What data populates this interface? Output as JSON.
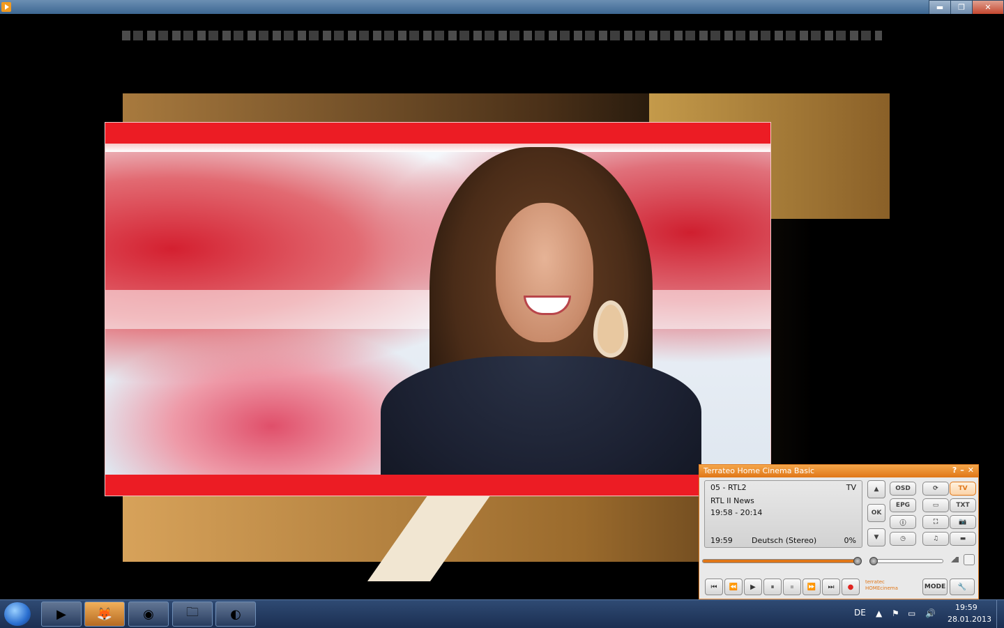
{
  "window": {
    "title": "",
    "minimize_label": "▬",
    "maximize_label": "❐",
    "close_label": "✕"
  },
  "player": {
    "title": "Terrateo Home Cinema Basic",
    "title_controls": [
      "?",
      "–",
      "✕"
    ],
    "display": {
      "channel": "05 - RTL2",
      "mode": "TV",
      "program": "RTL II News",
      "time_range": "19:58 - 20:14",
      "current_time": "19:59",
      "audio": "Deutsch (Stereo)",
      "percent": "0%"
    },
    "nav_buttons": {
      "up": "▲",
      "ok": "OK",
      "down": "▼"
    },
    "func_buttons": {
      "osd": "OSD",
      "epg": "EPG",
      "info": "ⓘ",
      "timer": "◷",
      "refresh": "⟳",
      "aspect": "▭",
      "fullscreen": "⛶",
      "music": "♫",
      "tv": "TV",
      "txt": "TXT",
      "snapshot": "📷",
      "bar": "▬"
    },
    "progress": 1.0,
    "volume": 0.0,
    "transport": {
      "prev": "⏮",
      "rewind": "⏪",
      "play": "▶",
      "pause": "⏸",
      "stop": "⏹",
      "forward": "⏩",
      "next": "⏭",
      "record": "●"
    },
    "logo": "terratec HOMEcinema",
    "mode_label": "MODE",
    "settings": "🔧",
    "accent": "#e07617"
  },
  "taskbar": {
    "items": [
      {
        "name": "media-player-app-icon",
        "glyph": "▶"
      },
      {
        "name": "firefox-app-icon",
        "glyph": "🦊"
      },
      {
        "name": "chrome-app-icon",
        "glyph": "◉"
      },
      {
        "name": "file-explorer-app-icon",
        "glyph": "🗀"
      },
      {
        "name": "media-center-app-icon",
        "glyph": "◐"
      }
    ],
    "language": "DE",
    "time": "19:59",
    "date": "28.01.2013"
  }
}
